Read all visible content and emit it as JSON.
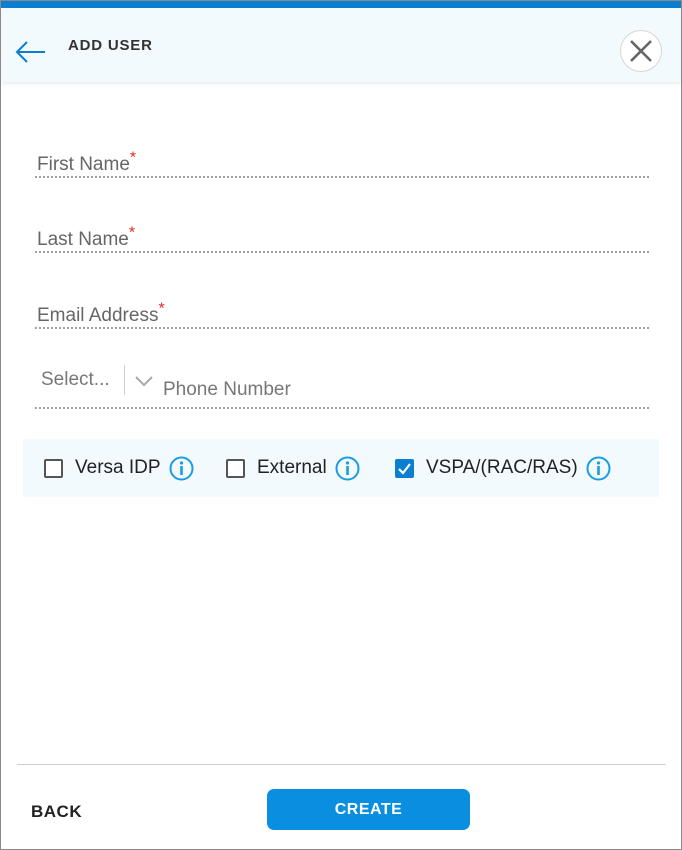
{
  "header": {
    "title": "ADD USER",
    "back_icon": "arrow-left-icon",
    "close_icon": "close-icon"
  },
  "form": {
    "first_name": {
      "label": "First Name",
      "required_mark": "*",
      "value": ""
    },
    "last_name": {
      "label": "Last Name",
      "required_mark": "*",
      "value": ""
    },
    "email": {
      "label": "Email Address",
      "required_mark": "*",
      "value": ""
    },
    "phone": {
      "country_placeholder": "Select...",
      "number_placeholder": "Phone Number"
    }
  },
  "options": [
    {
      "label": "Versa IDP",
      "checked": false
    },
    {
      "label": "External",
      "checked": false
    },
    {
      "label": "VSPA/(RAC/RAS)",
      "checked": true
    }
  ],
  "footer": {
    "back_label": "BACK",
    "create_label": "CREATE"
  },
  "colors": {
    "accent": "#0a7fd1",
    "button": "#0a8ee0",
    "header_bg": "#f2fafe",
    "required": "#e02424"
  }
}
